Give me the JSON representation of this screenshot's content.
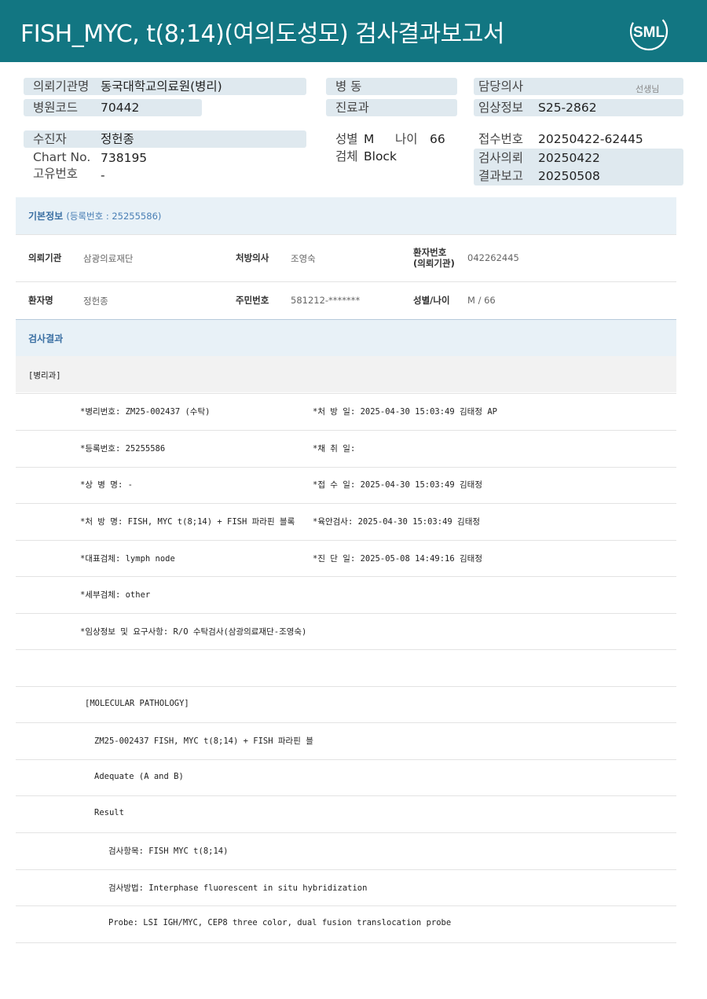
{
  "header": {
    "title": "FISH_MYC,  t(8;14)(여의도성모) 검사결과보고서",
    "logo_text": "SML"
  },
  "summary": {
    "referring_org_label": "의뢰기관명",
    "referring_org_value": "동국대학교의료원(병리)",
    "hospital_code_label": "병원코드",
    "hospital_code_value": "70442",
    "ward_label": "병   동",
    "dept_label": "진료과",
    "doctor_label": "담당의사",
    "doctor_suffix": "선생님",
    "clinical_info_label": "임상정보",
    "clinical_info_value": "S25-2862",
    "patient_label": "수진자",
    "patient_value": "정헌종",
    "chart_label": "Chart No.",
    "chart_value": "738195",
    "unique_label": "고유번호",
    "unique_value": "-",
    "sex_label": "성별",
    "sex_value": "M",
    "age_label": "나이",
    "age_value": "66",
    "specimen_label": "검체",
    "specimen_value": "Block",
    "receipt_no_label": "접수번호",
    "receipt_no_value": "20250422-62445",
    "request_label": "검사의뢰",
    "request_value": "20250422",
    "report_label": "결과보고",
    "report_value": "20250508"
  },
  "basic_info": {
    "title": "기본정보",
    "subtitle": "(등록번호 : 25255586)",
    "org_label": "의뢰기관",
    "org_value": "삼광의료재단",
    "prescriber_label": "처방의사",
    "prescriber_value": "조영숙",
    "patient_no_label_1": "환자번호",
    "patient_no_label_2": "(의뢰기관)",
    "patient_no_value": "042262445",
    "name_label": "환자명",
    "name_value": "정헌종",
    "rrn_label": "주민번호",
    "rrn_value": "581212-*******",
    "sexage_label": "성별/나이",
    "sexage_value": "M / 66"
  },
  "result": {
    "title": "검사결과",
    "dept": "[병리과]",
    "rows": [
      {
        "left": "*병리번호: ZM25-002437 (수탁)",
        "right": "*처 방 일: 2025-04-30 15:03:49  김태정 AP"
      },
      {
        "left": "*등록번호: 25255586",
        "right": "*채 취 일:"
      },
      {
        "left": "*상 병 명: -",
        "right": "*접 수 일: 2025-04-30 15:03:49  김태정"
      },
      {
        "left": "*처 방 명: FISH, MYC t(8;14) + FISH 파라핀 블록",
        "right": "*육안검사: 2025-04-30 15:03:49  김태정"
      },
      {
        "left": "*대표검체: lymph node",
        "right": "*진 단 일: 2025-05-08 14:49:16  김태정"
      },
      {
        "left": "*세부검체: other",
        "right": ""
      },
      {
        "left": "*임상정보 및 요구사항: R/O 수탁검사(삼광의료재단-조영숙)",
        "right": ""
      }
    ],
    "molecular_title": "[MOLECULAR PATHOLOGY]",
    "case_line": "ZM25-002437     FISH, MYC t(8;14) + FISH 파라핀 블",
    "adequacy": "Adequate (A and B)",
    "result_label": "Result",
    "test_item": "검사항목: FISH MYC t(8;14)",
    "method": "검사방법: Interphase fluorescent in situ hybridization",
    "probe": "Probe: LSI IGH/MYC, CEP8 three color, dual fusion translocation probe"
  }
}
